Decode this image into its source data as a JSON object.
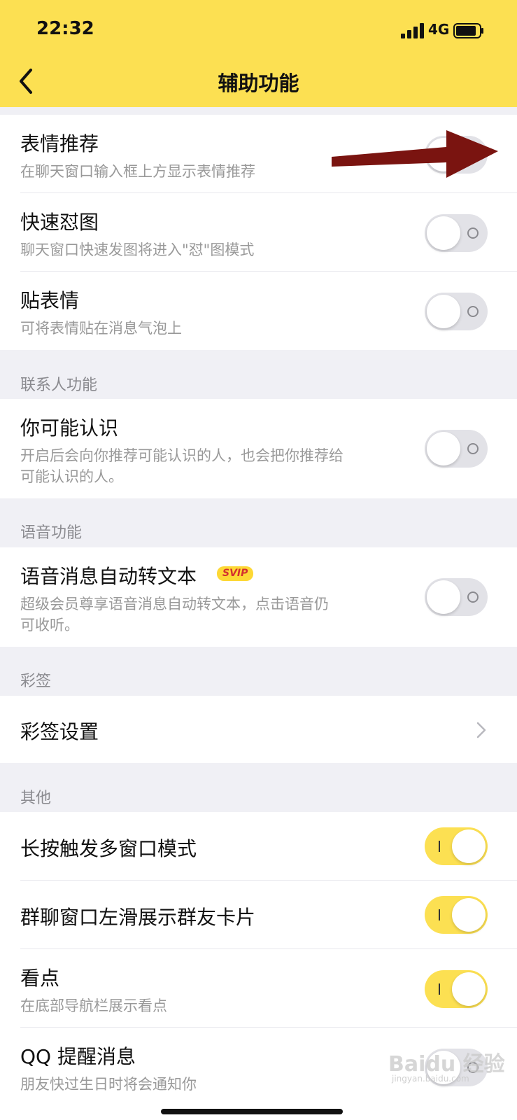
{
  "status_bar": {
    "time": "22:32",
    "network": "4G"
  },
  "nav": {
    "title": "辅助功能"
  },
  "sections": {
    "emoji": {
      "items": [
        {
          "title": "表情推荐",
          "subtitle": "在聊天窗口输入框上方显示表情推荐",
          "state": "off"
        },
        {
          "title": "快速怼图",
          "subtitle": "聊天窗口快速发图将进入\"怼\"图模式",
          "state": "off"
        },
        {
          "title": "贴表情",
          "subtitle": "可将表情贴在消息气泡上",
          "state": "off"
        }
      ]
    },
    "contacts": {
      "header": "联系人功能",
      "items": [
        {
          "title": "你可能认识",
          "subtitle_line1": "开启后会向你推荐可能认识的人，也会把你推荐给",
          "subtitle_line2": "可能认识的人。",
          "state": "off"
        }
      ]
    },
    "voice": {
      "header": "语音功能",
      "items": [
        {
          "title": "语音消息自动转文本",
          "badge": "SVIP",
          "subtitle_line1": "超级会员尊享语音消息自动转文本，点击语音仍",
          "subtitle_line2": "可收听。",
          "state": "off"
        }
      ]
    },
    "caiqian": {
      "header": "彩签",
      "items": [
        {
          "title": "彩签设置"
        }
      ]
    },
    "other": {
      "header": "其他",
      "items": [
        {
          "title": "长按触发多窗口模式",
          "state": "on"
        },
        {
          "title": "群聊窗口左滑展示群友卡片",
          "state": "on"
        },
        {
          "title": "看点",
          "subtitle": "在底部导航栏展示看点",
          "state": "on"
        },
        {
          "title": "QQ 提醒消息",
          "subtitle": "朋友快过生日时将会通知你",
          "state": "off"
        }
      ]
    }
  },
  "watermark": {
    "text": "Baidu 经验",
    "sub": "jingyan.baidu.com"
  },
  "colors": {
    "accent": "#FCE052",
    "background": "#F0F0F5",
    "annotation_arrow": "#7A1410",
    "badge_text": "#D32F2F"
  }
}
